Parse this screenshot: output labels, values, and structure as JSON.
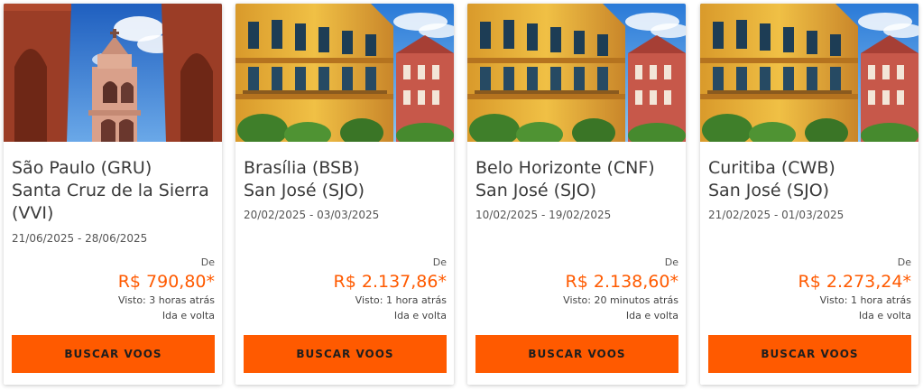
{
  "colors": {
    "accent": "#ff5a00",
    "text": "#3a3a3a"
  },
  "cards": [
    {
      "image": "church-tower-photo",
      "origin": "São Paulo (GRU)",
      "destination": "Santa Cruz de la Sierra (VVI)",
      "dates": "21/06/2025 - 28/06/2025",
      "from_label": "De",
      "price": "R$ 790,80*",
      "seen": "Visto: 3 horas atrás",
      "trip_type": "Ida e volta",
      "button": "BUSCAR VOOS"
    },
    {
      "image": "colonial-building-photo",
      "origin": "Brasília (BSB)",
      "destination": "San José (SJO)",
      "dates": "20/02/2025 - 03/03/2025",
      "from_label": "De",
      "price": "R$ 2.137,86*",
      "seen": "Visto: 1 hora atrás",
      "trip_type": "Ida e volta",
      "button": "BUSCAR VOOS"
    },
    {
      "image": "colonial-building-photo",
      "origin": "Belo Horizonte (CNF)",
      "destination": "San José (SJO)",
      "dates": "10/02/2025 - 19/02/2025",
      "from_label": "De",
      "price": "R$ 2.138,60*",
      "seen": "Visto: 20 minutos atrás",
      "trip_type": "Ida e volta",
      "button": "BUSCAR VOOS"
    },
    {
      "image": "colonial-building-photo",
      "origin": "Curitiba (CWB)",
      "destination": "San José (SJO)",
      "dates": "21/02/2025 - 01/03/2025",
      "from_label": "De",
      "price": "R$ 2.273,24*",
      "seen": "Visto: 1 hora atrás",
      "trip_type": "Ida e volta",
      "button": "BUSCAR VOOS"
    }
  ]
}
